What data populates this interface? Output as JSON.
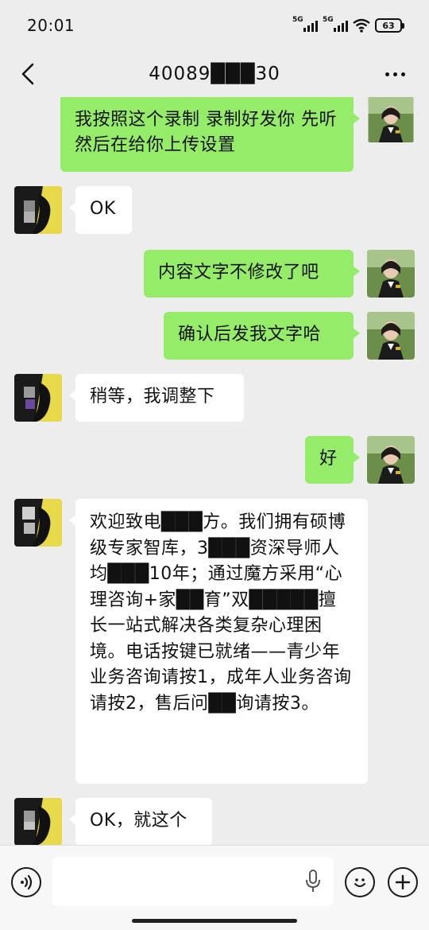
{
  "status_bar": {
    "time": "20:01",
    "signal_1_label": "5G",
    "signal_2_label": "5G",
    "battery": "63"
  },
  "nav": {
    "title": "40089███30"
  },
  "messages": [
    {
      "side": "mine",
      "text": "我按照这个录制 录制好发你 先听 然后在给你上传设置"
    },
    {
      "side": "theirs",
      "text": "OK"
    },
    {
      "side": "mine",
      "text": "内容文字不修改了吧"
    },
    {
      "side": "mine",
      "text": "确认后发我文字哈"
    },
    {
      "side": "theirs",
      "text": "稍等，我调整下"
    },
    {
      "side": "mine",
      "text": "好"
    },
    {
      "side": "theirs",
      "text": "欢迎致电███方。我们拥有硕博级专家智库，3███资深导师人均███10年；通过魔方采用“心理咨询+家██育”双█████擅长一站式解决各类复杂心理困境。电话按键已就绪——青少年业务咨询请按1，成年人业务咨询请按2，售后问██询请按3。"
    },
    {
      "side": "theirs",
      "text": "OK，就这个"
    }
  ],
  "icons": {
    "back": "chevron-left-icon",
    "more": "more-dots-icon",
    "voice": "voice-icon",
    "mic": "microphone-icon",
    "emoji": "emoji-icon",
    "plus": "plus-icon"
  },
  "colors": {
    "my_bubble": "#95ec69",
    "their_bubble": "#ffffff",
    "background": "#ededed"
  }
}
